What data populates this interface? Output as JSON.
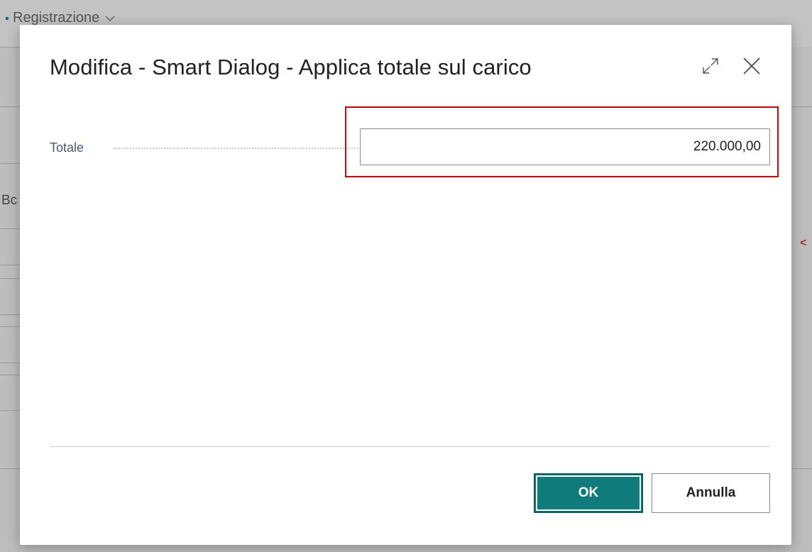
{
  "background": {
    "tab_label": "Registrazione",
    "partial_text": "Bc",
    "partial_mark": "<"
  },
  "dialog": {
    "title": "Modifica - Smart Dialog - Applica totale sul carico",
    "expand_icon": "expand-icon",
    "close_icon": "close-icon",
    "field": {
      "label": "Totale",
      "value": "220.000,00"
    },
    "buttons": {
      "ok": "OK",
      "cancel": "Annulla"
    }
  },
  "colors": {
    "primary": "#0f7b7b",
    "highlight": "#e00000"
  }
}
